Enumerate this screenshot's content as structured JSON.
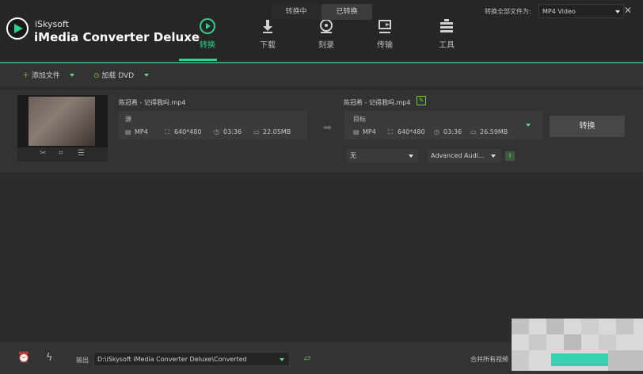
{
  "app": {
    "brand_small": "iSkysoft",
    "brand_big": "iMedia Converter Deluxe",
    "window_controls": "≡ — □ ✕",
    "accent": "#2dd08a"
  },
  "nav": {
    "tabs": [
      {
        "label": "转换",
        "icon": "convert-icon",
        "active": true
      },
      {
        "label": "下载",
        "icon": "download-icon",
        "active": false
      },
      {
        "label": "刻录",
        "icon": "burn-icon",
        "active": false
      },
      {
        "label": "传输",
        "icon": "transfer-icon",
        "active": false
      },
      {
        "label": "工具",
        "icon": "toolbox-icon",
        "active": false
      }
    ]
  },
  "toolbar": {
    "add_files": "添加文件",
    "load_dvd": "加载 DVD",
    "tab_converting": "转换中",
    "tab_converted": "已转换",
    "convert_all_label": "转换全部文件为:",
    "format_selected": "MP4 Video"
  },
  "row": {
    "source_name": "陈冠希 - 记得我吗.mp4",
    "target_name": "陈冠希 - 记得我吗.mp4",
    "source": {
      "label": "源",
      "format": "MP4",
      "resolution": "640*480",
      "duration": "03:36",
      "size": "22.05MB"
    },
    "target": {
      "label": "目标",
      "format": "MP4",
      "resolution": "640*480",
      "duration": "03:36",
      "size": "26.59MB"
    },
    "convert_button": "转换",
    "subtitle_select": "无",
    "audio_select": "Advanced Audi..."
  },
  "bottom": {
    "output_label": "输出",
    "output_path": "D:\\iSkysoft iMedia Converter Deluxe\\Converted",
    "merge_label": "合并所有视频"
  }
}
